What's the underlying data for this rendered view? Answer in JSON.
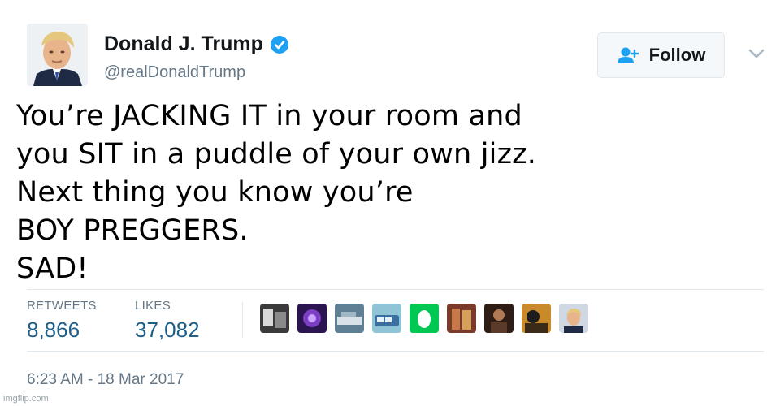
{
  "author": {
    "display_name": "Donald J. Trump",
    "handle": "@realDonaldTrump",
    "verified": true
  },
  "follow_button": {
    "label": "Follow",
    "icon": "add-user-icon"
  },
  "menu": {
    "icon": "chevron-down-icon"
  },
  "tweet": {
    "lines": [
      "You’re JACKING IT in your room and",
      "you SIT in a puddle of your own jizz.",
      "Next thing you know you’re",
      "BOY PREGGERS.",
      "SAD!"
    ]
  },
  "stats": {
    "retweets_label": "RETWEETS",
    "retweets_value": "8,866",
    "likes_label": "LIKES",
    "likes_value": "37,082"
  },
  "likers_count_shown": 9,
  "timestamp": "6:23 AM - 18 Mar 2017",
  "watermark": "imgflip.com",
  "colors": {
    "verified_blue": "#1da1f2",
    "count_blue": "#1b5f8a",
    "muted_gray": "#657786"
  }
}
